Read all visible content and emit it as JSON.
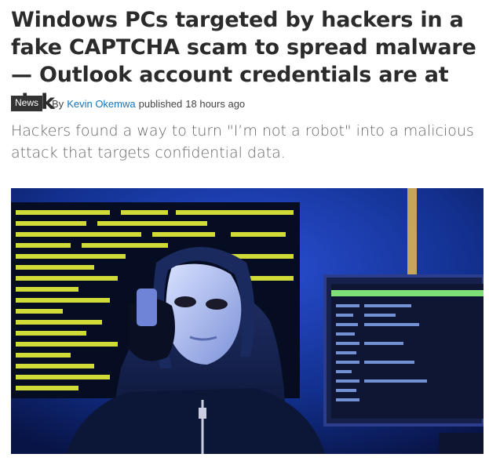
{
  "article": {
    "headline": "Windows PCs targeted by hackers in a fake CAPTCHA scam to spread malware — Outlook account credentials are at risk",
    "category_badge": "News",
    "byline_prefix": "By",
    "author": "Kevin Okemwa",
    "published_label": "published",
    "published_time": "18 hours ago",
    "strapline": "Hackers found a way to turn \"I’m not a robot\" into a malicious attack that targets confidential data.",
    "hero_image": {
      "description_icon": "hacker-with-mask-image",
      "colors": {
        "background": "#0b1e6a",
        "screen_text": "#e6f23a",
        "hoodie": "#0f1a3c",
        "mask": "#b8c6f0"
      }
    }
  }
}
